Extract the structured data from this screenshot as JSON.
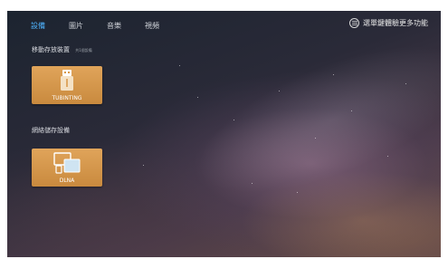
{
  "tabs": [
    {
      "label": "設備",
      "active": true
    },
    {
      "label": "圖片",
      "active": false
    },
    {
      "label": "音樂",
      "active": false
    },
    {
      "label": "視頻",
      "active": false
    }
  ],
  "menu_hint": {
    "icon": "menu-lines-icon",
    "text": "選單鍵體驗更多功能"
  },
  "sections": [
    {
      "title": "移動存放裝置",
      "subtitle": "共1個設備",
      "tiles": [
        {
          "label": "TUBINTING",
          "icon": "usb-drive-icon"
        }
      ]
    },
    {
      "title": "網絡儲存設備",
      "tiles": [
        {
          "label": "DLNA",
          "icon": "network-devices-icon"
        }
      ]
    }
  ],
  "colors": {
    "active_tab": "#4fb4ff",
    "tile": "#d99a4c"
  }
}
